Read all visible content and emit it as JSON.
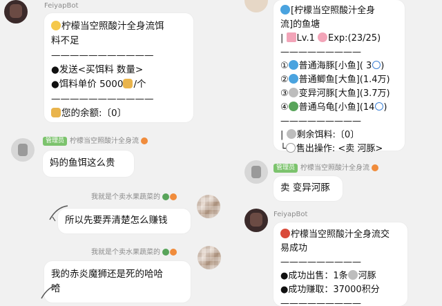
{
  "colors": {
    "bg": "#f1f1f1",
    "bubble": "#ffffff",
    "badge": "#7cc36d",
    "name": "#8a8a8a"
  },
  "left": {
    "bot_name": "FeiyapBot",
    "bot_msg": {
      "line1": "柠檬当空照酸汁全身流饵",
      "line2": "料不足",
      "div1": "———————————",
      "line3": "●发送<买饵料 数量>",
      "line4a": "●饵料单价  5000",
      "line4b": "/个",
      "div2": "———————————",
      "line5": "您的余额:〔0〕"
    },
    "admin_badge": "管理员",
    "admin_name": "柠檬当空照酸汁全身流",
    "admin_msg": "妈的鱼饵这么贵",
    "user2_name": "我就是个卖水果蔬菜的",
    "user2_msg1": "所以先要弄清楚怎么赚钱",
    "user2_msg2_l1": "我的赤炎魔狮还是死的哈哈",
    "user2_msg2_l2": "哈"
  },
  "right": {
    "pond": {
      "title_l1": "[柠檬当空照酸汁全身",
      "title_l2": "流]的鱼塘",
      "lv": "Lv.1",
      "exp": "Exp:(23/25)",
      "div1": "—————————",
      "fish": [
        {
          "num": "①",
          "text": "普通海豚[小鱼]( 3",
          "tail": ")"
        },
        {
          "num": "②",
          "text": "普通鲫鱼[大鱼](1.4万)",
          "tail": ""
        },
        {
          "num": "③",
          "text": "变异河豚[大鱼](3.7万)",
          "tail": ""
        },
        {
          "num": "④",
          "text": "普通乌龟[小鱼](14",
          "tail": ")"
        }
      ],
      "div2": "—————————",
      "bait": "剩余饵料:〔0〕",
      "sell": "售出操作: <卖 河豚>"
    },
    "admin_badge": "管理员",
    "admin_name": "柠檬当空照酸汁全身流",
    "admin_msg": "卖 变异河豚",
    "bot_name": "FeiyapBot",
    "trade": {
      "line1": "柠檬当空照酸汁全身流交",
      "line2": "易成功",
      "div1": "—————————",
      "line3a": "●成功出售：1条",
      "line3b": "河豚",
      "line4": "●成功赚取：37000积分",
      "div2": "—————————"
    }
  }
}
